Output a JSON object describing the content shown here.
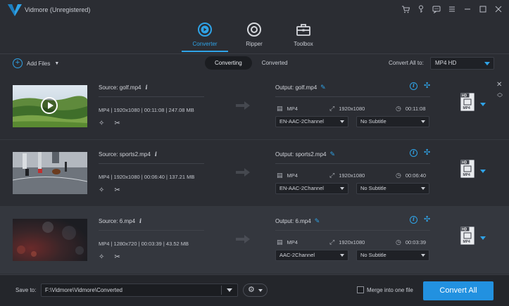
{
  "app": {
    "title": "Vidmore (Unregistered)"
  },
  "main_tabs": [
    {
      "label": "Converter",
      "active": true
    },
    {
      "label": "Ripper",
      "active": false
    },
    {
      "label": "Toolbox",
      "active": false
    }
  ],
  "toolbar": {
    "add_files_label": "Add Files",
    "segments": [
      "Converting",
      "Converted"
    ],
    "convert_all_label": "Convert All to:",
    "convert_all_value": "MP4 HD"
  },
  "items": [
    {
      "source": "Source: golf.mp4",
      "meta": "MP4 | 1920x1080 | 00:11:08 | 247.08 MB",
      "output": "Output: golf.mp4",
      "out_format": "MP4",
      "out_resolution": "1920x1080",
      "out_duration": "00:11:08",
      "audio": "EN-AAC-2Channel",
      "subtitle": "No Subtitle"
    },
    {
      "source": "Source: sports2.mp4",
      "meta": "MP4 | 1920x1080 | 00:06:40 | 137.21 MB",
      "output": "Output: sports2.mp4",
      "out_format": "MP4",
      "out_resolution": "1920x1080",
      "out_duration": "00:06:40",
      "audio": "EN-AAC-2Channel",
      "subtitle": "No Subtitle"
    },
    {
      "source": "Source: 6.mp4",
      "meta": "MP4 | 1280x720 | 00:03:39 | 43.52 MB",
      "output": "Output: 6.mp4",
      "out_format": "MP4",
      "out_resolution": "1920x1080",
      "out_duration": "00:03:39",
      "audio": "AAC-2Channel",
      "subtitle": "No Subtitle"
    }
  ],
  "format_badge": {
    "top": "HD",
    "bottom": "MP4"
  },
  "bottom": {
    "save_to_label": "Save to:",
    "save_path": "F:\\Vidmore\\Vidmore\\Converted",
    "merge_label": "Merge into one file",
    "convert_all_button": "Convert All"
  },
  "colors": {
    "accent": "#2fa3e7",
    "button": "#2291e0",
    "background": "#2b2d33"
  }
}
